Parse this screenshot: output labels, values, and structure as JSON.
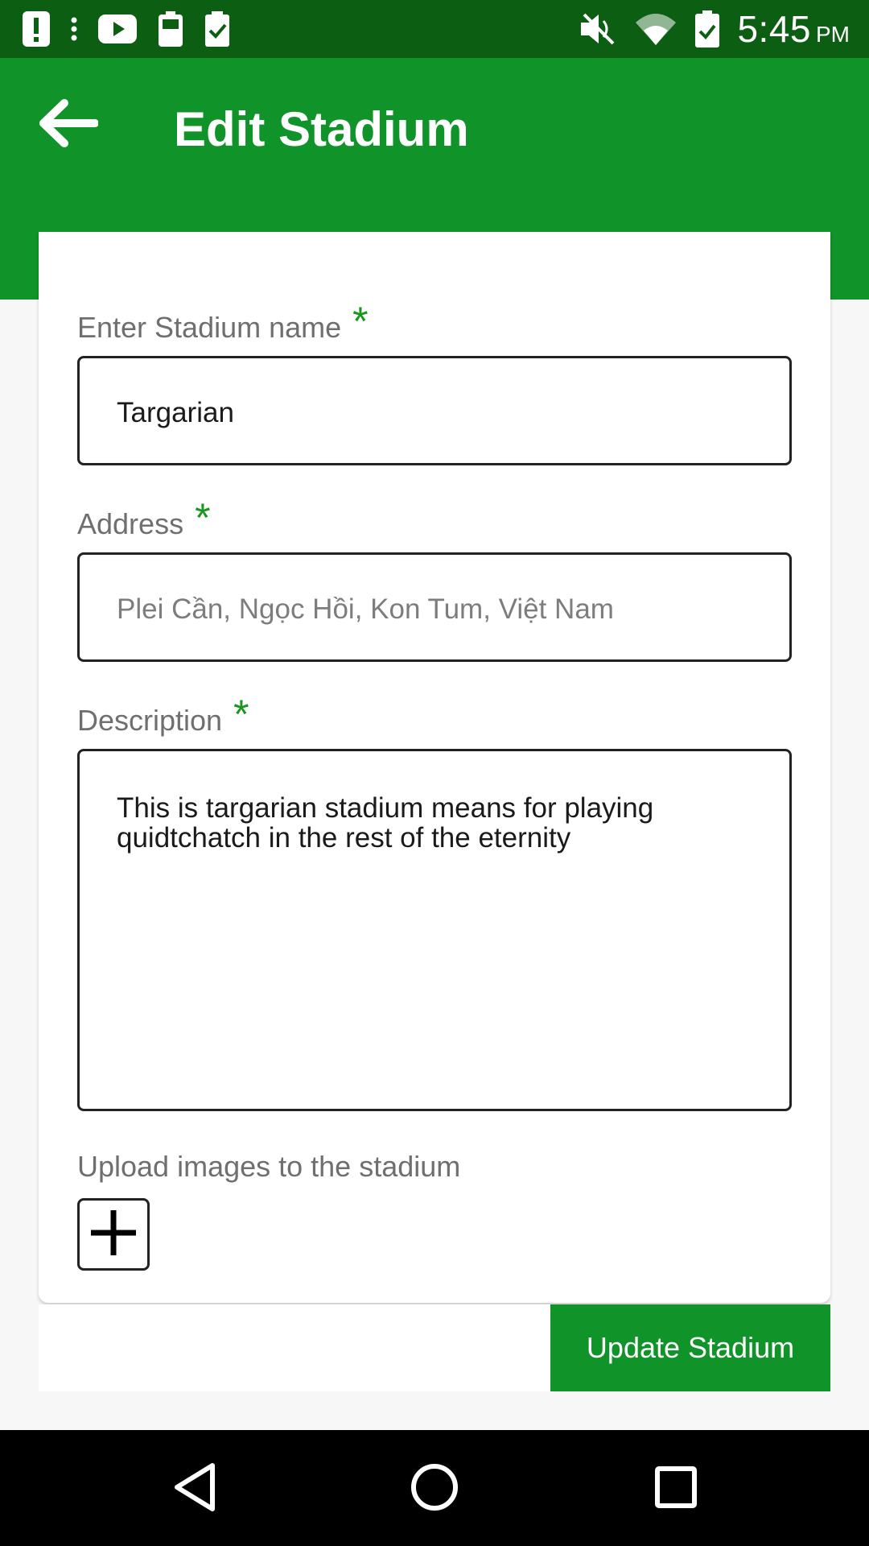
{
  "status_bar": {
    "time": "5:45",
    "ampm": "PM",
    "icons": [
      "alert-icon",
      "more-vert-icon",
      "youtube-icon",
      "battery-saver-icon",
      "clipboard-check-icon",
      "mute-icon",
      "wifi-icon",
      "battery-icon"
    ]
  },
  "app_bar": {
    "title": "Edit Stadium",
    "color": "#109329"
  },
  "form": {
    "name": {
      "label": "Enter Stadium name",
      "required": "*",
      "value": "Targarian"
    },
    "address": {
      "label": "Address",
      "required": "*",
      "placeholder": "Plei Cần, Ngọc Hồi, Kon Tum, Việt Nam"
    },
    "description": {
      "label": "Description",
      "required": "*",
      "value": "This is targarian stadium means for playing quidtchatch in the rest of the eternity"
    },
    "upload": {
      "label": "Upload images to the stadium"
    }
  },
  "actions": {
    "update_label": "Update Stadium"
  },
  "nav_bar": {
    "icons": [
      "back-triangle-icon",
      "home-circle-icon",
      "recents-square-icon"
    ]
  }
}
